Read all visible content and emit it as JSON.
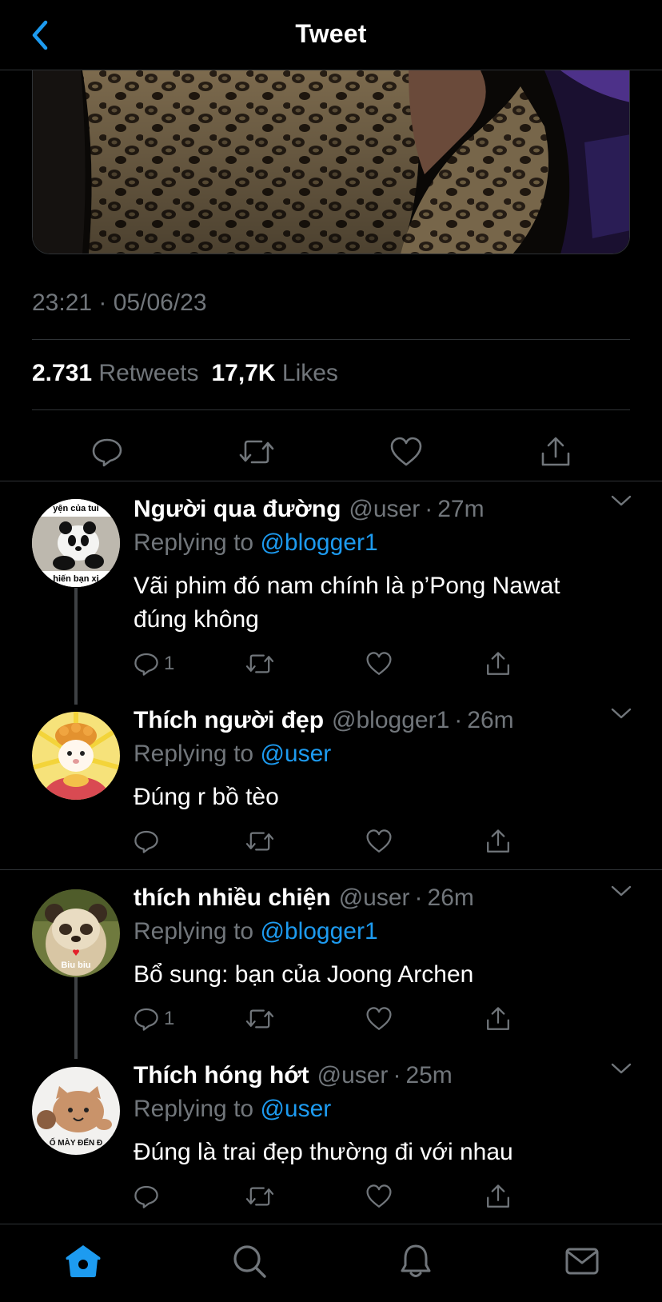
{
  "header": {
    "title": "Tweet",
    "back_icon": "chevron-left-icon",
    "accent": "#1d9bf0"
  },
  "tweet": {
    "timestamp": "23:21 · 05/06/23",
    "retweets_count": "2.731",
    "retweets_label": "Retweets",
    "likes_count": "17,7K",
    "likes_label": "Likes"
  },
  "replies": [
    {
      "name": "Người qua đường",
      "handle": "@user",
      "time": "27m",
      "replying_prefix": "Replying to",
      "replying_to": "@blogger1",
      "text": "Vãi phim đó nam chính là p’Pong Nawat đúng không",
      "reply_count": "1",
      "avatar_caption_top": "yện của tui",
      "avatar_caption_bottom": "hiến bạn xi"
    },
    {
      "name": "Thích người đẹp",
      "handle": "@blogger1",
      "time": "26m",
      "replying_prefix": "Replying to",
      "replying_to": "@user",
      "text": "Đúng r bồ tèo",
      "reply_count": ""
    },
    {
      "name": "thích nhiều chiện",
      "handle": "@user",
      "time": "26m",
      "replying_prefix": "Replying to",
      "replying_to": "@blogger1",
      "text": "Bổ sung: bạn của Joong Archen",
      "reply_count": "1",
      "avatar_caption": "Biu biu"
    },
    {
      "name": "Thích hóng hớt",
      "handle": "@user",
      "time": "25m",
      "replying_prefix": "Replying to",
      "replying_to": "@user",
      "text": "Đúng là trai đẹp thường đi với nhau",
      "reply_count": "",
      "avatar_caption": "Ố MÀY ĐẾN Đ"
    }
  ],
  "tabbar": {
    "items": [
      "home-icon",
      "search-icon",
      "notifications-icon",
      "messages-icon"
    ],
    "active": "home-icon"
  }
}
